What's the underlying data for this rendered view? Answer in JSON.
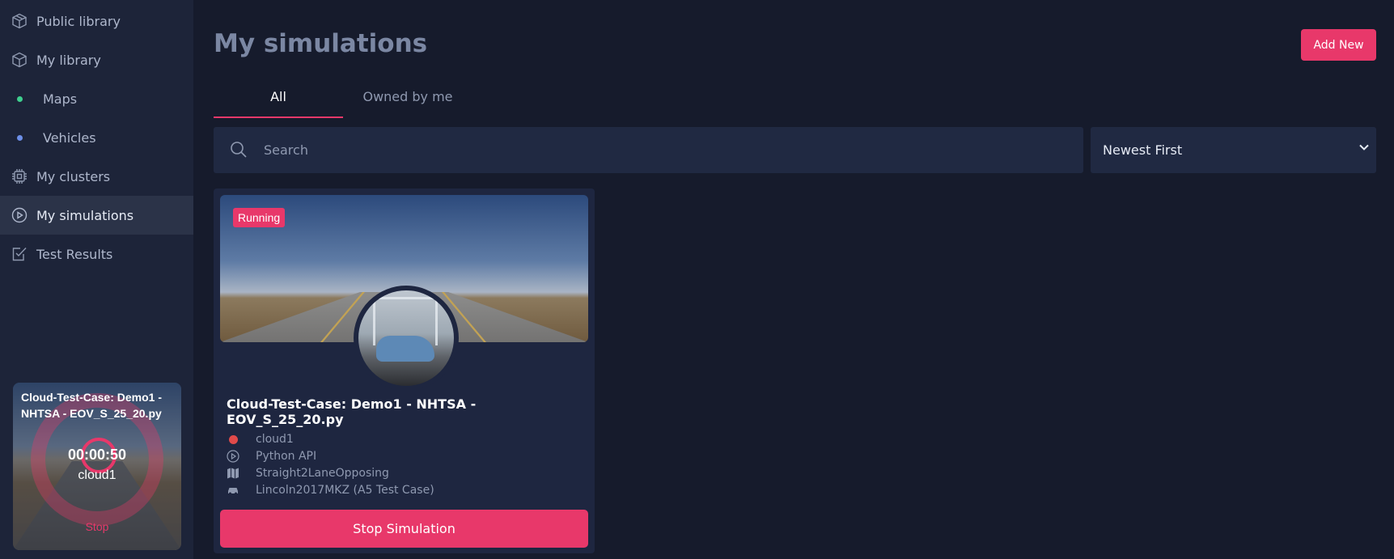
{
  "sidebar": {
    "items": [
      {
        "label": "Public library",
        "icon": "cube-icon"
      },
      {
        "label": "My library",
        "icon": "cube-icon"
      },
      {
        "label": "Maps",
        "icon": "dot-icon",
        "dot_color": "#3ecf8e"
      },
      {
        "label": "Vehicles",
        "icon": "dot-icon",
        "dot_color": "#6d8fe8"
      },
      {
        "label": "My clusters",
        "icon": "chip-icon"
      },
      {
        "label": "My simulations",
        "icon": "play-circle-icon"
      },
      {
        "label": "Test Results",
        "icon": "checklist-icon"
      }
    ],
    "active": "My simulations"
  },
  "mini_player": {
    "title": "Cloud-Test-Case: Demo1 - NHTSA - EOV_S_25_20.py",
    "timer": "00:00:50",
    "cluster": "cloud1",
    "stop_label": "Stop"
  },
  "header": {
    "title": "My simulations",
    "add_label": "Add New"
  },
  "tabs": [
    {
      "label": "All",
      "active": true
    },
    {
      "label": "Owned by me",
      "active": false
    }
  ],
  "search": {
    "placeholder": "Search",
    "value": ""
  },
  "sort": {
    "selected": "Newest First"
  },
  "cards": [
    {
      "status": "Running",
      "title": "Cloud-Test-Case: Demo1 - NHTSA - EOV_S_25_20.py",
      "cluster": "cloud1",
      "cluster_status_color": "#e04a4a",
      "runtime": "Python API",
      "map": "Straight2LaneOpposing",
      "vehicle": "Lincoln2017MKZ (A5 Test Case)",
      "stop_label": "Stop Simulation"
    }
  ],
  "colors": {
    "accent": "#e8386a",
    "background": "#161b2c",
    "sidebar": "#1d2439",
    "card": "#1e2640"
  }
}
